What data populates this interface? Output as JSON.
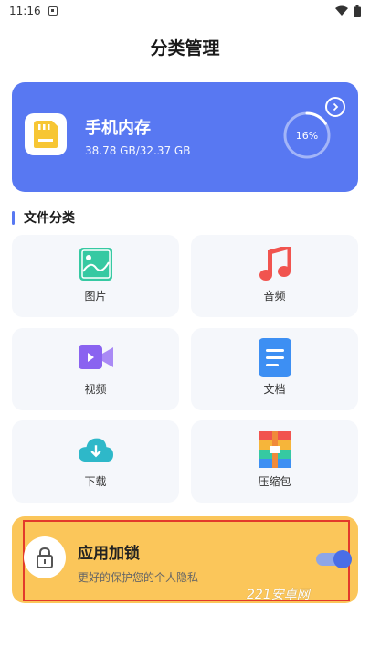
{
  "status_bar": {
    "time": "11:16",
    "icons": [
      "notification-icon",
      "wifi-icon",
      "battery-icon"
    ]
  },
  "header": {
    "title": "分类管理"
  },
  "storage": {
    "title": "手机内存",
    "usage": "38.78 GB/32.37 GB",
    "percent_label": "16%",
    "percent": 0.16,
    "icon": "sd-card-icon",
    "accent": "#5878f2"
  },
  "section": {
    "label": "文件分类"
  },
  "categories": [
    {
      "label": "图片",
      "icon": "image-icon",
      "color": "#36c9a2"
    },
    {
      "label": "音频",
      "icon": "music-icon",
      "color": "#f1544f"
    },
    {
      "label": "视频",
      "icon": "video-icon",
      "color": "#8a63f0"
    },
    {
      "label": "文档",
      "icon": "document-icon",
      "color": "#3d8ff3"
    },
    {
      "label": "下载",
      "icon": "download-cloud-icon",
      "color": "#2eb8c9"
    },
    {
      "label": "压缩包",
      "icon": "archive-icon",
      "color": "#f08a3a"
    }
  ],
  "app_lock": {
    "title": "应用加锁",
    "subtitle": "更好的保护您的个人隐私",
    "icon": "lock-icon",
    "enabled": true,
    "background": "#fbc65a"
  },
  "watermark": "221安卓网"
}
